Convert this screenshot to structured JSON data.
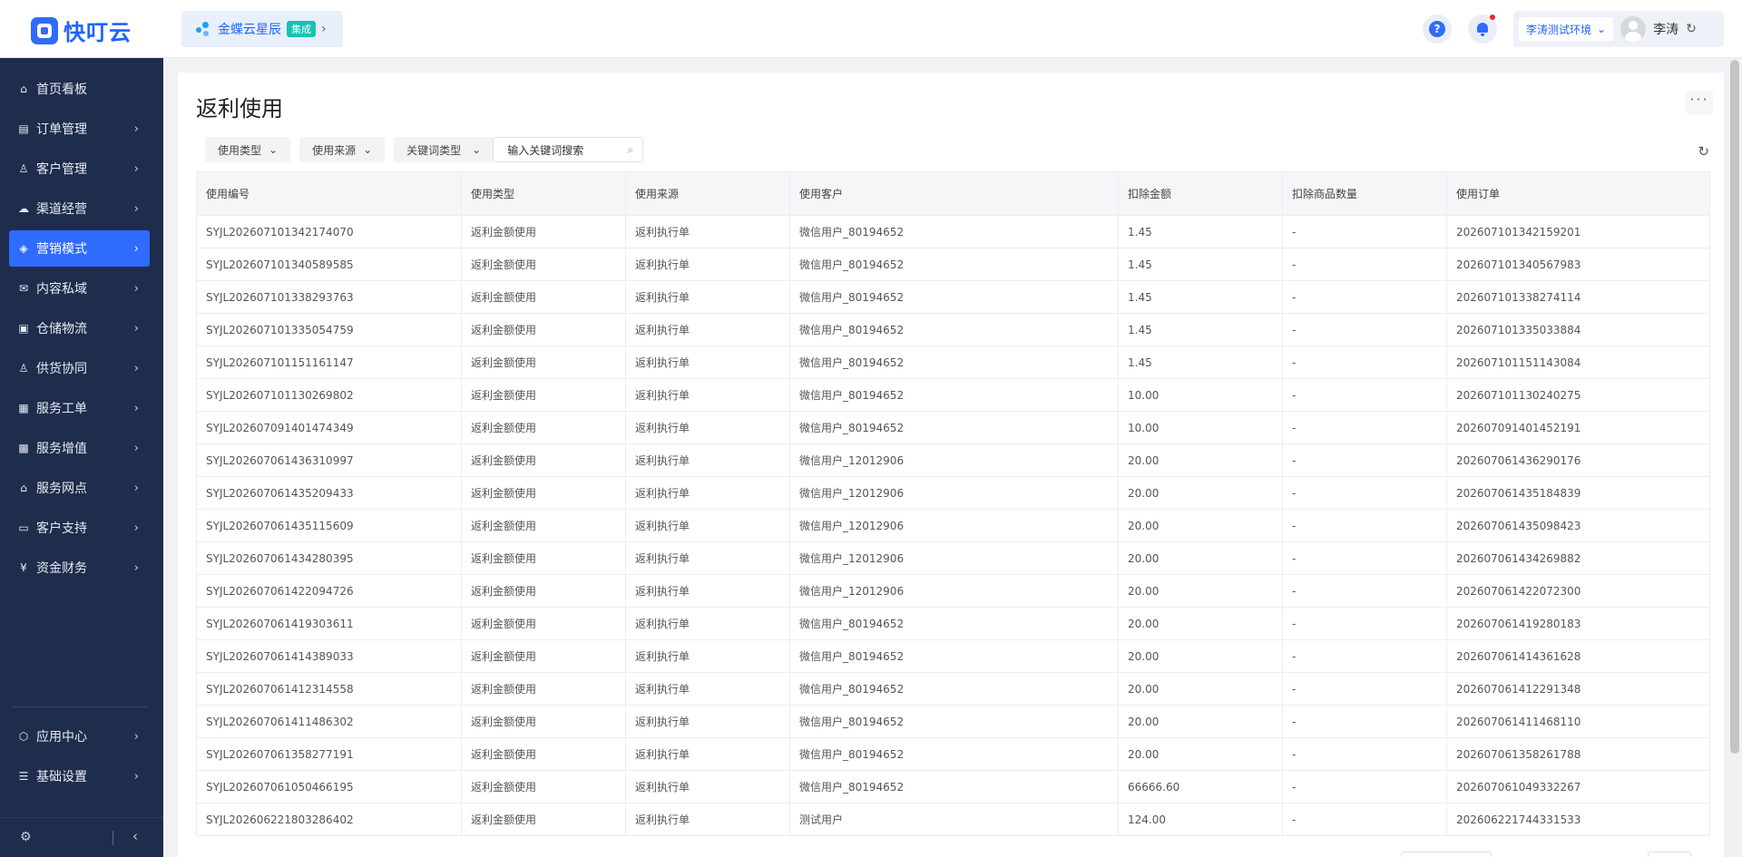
{
  "app": {
    "logo_text": "快叮云",
    "brand_name": "金蝶云星辰",
    "brand_tag": "集成",
    "environment": "李涛测试环境",
    "user_name": "李涛"
  },
  "sidebar": {
    "items": [
      {
        "label": "首页看板",
        "icon": "home-icon"
      },
      {
        "label": "订单管理",
        "icon": "order-icon"
      },
      {
        "label": "客户管理",
        "icon": "customer-icon"
      },
      {
        "label": "渠道经营",
        "icon": "channel-icon"
      },
      {
        "label": "营销模式",
        "icon": "marketing-icon"
      },
      {
        "label": "内容私域",
        "icon": "content-icon"
      },
      {
        "label": "仓储物流",
        "icon": "warehouse-icon"
      },
      {
        "label": "供货协同",
        "icon": "supply-icon"
      },
      {
        "label": "服务工单",
        "icon": "service-order-icon"
      },
      {
        "label": "服务增值",
        "icon": "service-value-icon"
      },
      {
        "label": "服务网点",
        "icon": "service-point-icon"
      },
      {
        "label": "客户支持",
        "icon": "support-icon"
      },
      {
        "label": "资金财务",
        "icon": "finance-icon"
      }
    ],
    "bottom_items": [
      {
        "label": "应用中心",
        "icon": "app-center-icon"
      },
      {
        "label": "基础设置",
        "icon": "settings-list-icon"
      }
    ],
    "active_index": 4
  },
  "page": {
    "title": "返利使用",
    "filters": {
      "usage_type": "使用类型",
      "usage_source": "使用来源",
      "keyword_type": "关键词类型",
      "search_placeholder": "输入关键词搜索"
    }
  },
  "table": {
    "columns": [
      "使用编号",
      "使用类型",
      "使用来源",
      "使用客户",
      "扣除金额",
      "扣除商品数量",
      "使用订单"
    ],
    "rows": [
      [
        "SYJL202607101342174070",
        "返利金额使用",
        "返利执行单",
        "微信用户_80194652",
        "1.45",
        "-",
        "202607101342159201"
      ],
      [
        "SYJL202607101340589585",
        "返利金额使用",
        "返利执行单",
        "微信用户_80194652",
        "1.45",
        "-",
        "202607101340567983"
      ],
      [
        "SYJL202607101338293763",
        "返利金额使用",
        "返利执行单",
        "微信用户_80194652",
        "1.45",
        "-",
        "202607101338274114"
      ],
      [
        "SYJL202607101335054759",
        "返利金额使用",
        "返利执行单",
        "微信用户_80194652",
        "1.45",
        "-",
        "202607101335033884"
      ],
      [
        "SYJL202607101151161147",
        "返利金额使用",
        "返利执行单",
        "微信用户_80194652",
        "1.45",
        "-",
        "202607101151143084"
      ],
      [
        "SYJL202607101130269802",
        "返利金额使用",
        "返利执行单",
        "微信用户_80194652",
        "10.00",
        "-",
        "202607101130240275"
      ],
      [
        "SYJL202607091401474349",
        "返利金额使用",
        "返利执行单",
        "微信用户_80194652",
        "10.00",
        "-",
        "202607091401452191"
      ],
      [
        "SYJL202607061436310997",
        "返利金额使用",
        "返利执行单",
        "微信用户_12012906",
        "20.00",
        "-",
        "202607061436290176"
      ],
      [
        "SYJL202607061435209433",
        "返利金额使用",
        "返利执行单",
        "微信用户_12012906",
        "20.00",
        "-",
        "202607061435184839"
      ],
      [
        "SYJL202607061435115609",
        "返利金额使用",
        "返利执行单",
        "微信用户_12012906",
        "20.00",
        "-",
        "202607061435098423"
      ],
      [
        "SYJL202607061434280395",
        "返利金额使用",
        "返利执行单",
        "微信用户_12012906",
        "20.00",
        "-",
        "202607061434269882"
      ],
      [
        "SYJL202607061422094726",
        "返利金额使用",
        "返利执行单",
        "微信用户_12012906",
        "20.00",
        "-",
        "202607061422072300"
      ],
      [
        "SYJL202607061419303611",
        "返利金额使用",
        "返利执行单",
        "微信用户_80194652",
        "20.00",
        "-",
        "202607061419280183"
      ],
      [
        "SYJL202607061414389033",
        "返利金额使用",
        "返利执行单",
        "微信用户_80194652",
        "20.00",
        "-",
        "202607061414361628"
      ],
      [
        "SYJL202607061412314558",
        "返利金额使用",
        "返利执行单",
        "微信用户_80194652",
        "20.00",
        "-",
        "202607061412291348"
      ],
      [
        "SYJL202607061411486302",
        "返利金额使用",
        "返利执行单",
        "微信用户_80194652",
        "20.00",
        "-",
        "202607061411468110"
      ],
      [
        "SYJL202607061358277191",
        "返利金额使用",
        "返利执行单",
        "微信用户_80194652",
        "20.00",
        "-",
        "202607061358261788"
      ],
      [
        "SYJL202607061050466195",
        "返利金额使用",
        "返利执行单",
        "微信用户_80194652",
        "66666.60",
        "-",
        "202607061049332267"
      ],
      [
        "SYJL202606221803286402",
        "返利金额使用",
        "返利执行单",
        "测试用户",
        "124.00",
        "-",
        "202606221744331533"
      ]
    ]
  },
  "colors": {
    "accent": "#2f6bff",
    "sidebar_bg": "#1f2d4d",
    "brand_tag": "#16c2b4"
  }
}
